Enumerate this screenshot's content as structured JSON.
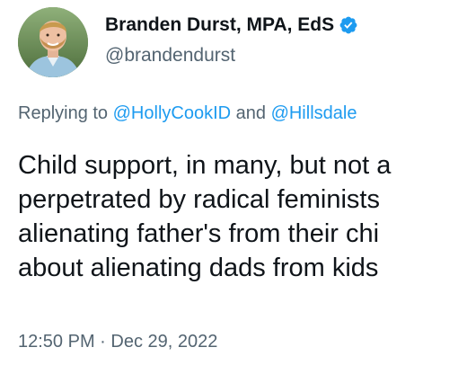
{
  "author": {
    "display_name": "Branden Durst, MPA, EdS",
    "handle": "@brandendurst",
    "verified_icon": "verified-badge-icon",
    "avatar_icon": "profile-photo"
  },
  "reply": {
    "prefix": "Replying to ",
    "mention_1": "@HollyCookID",
    "conjunction": " and ",
    "mention_2": "@Hillsdale"
  },
  "tweet": {
    "lines": [
      "Child support, in many, but not a",
      "perpetrated by radical feminists",
      "alienating father's from their chi",
      "about alienating dads from kids"
    ]
  },
  "meta": {
    "time": "12:50 PM",
    "separator": " · ",
    "date": "Dec 29, 2022"
  },
  "colors": {
    "accent": "#1d9bf0",
    "secondary_text": "#536471",
    "primary_text": "#0f1419"
  }
}
